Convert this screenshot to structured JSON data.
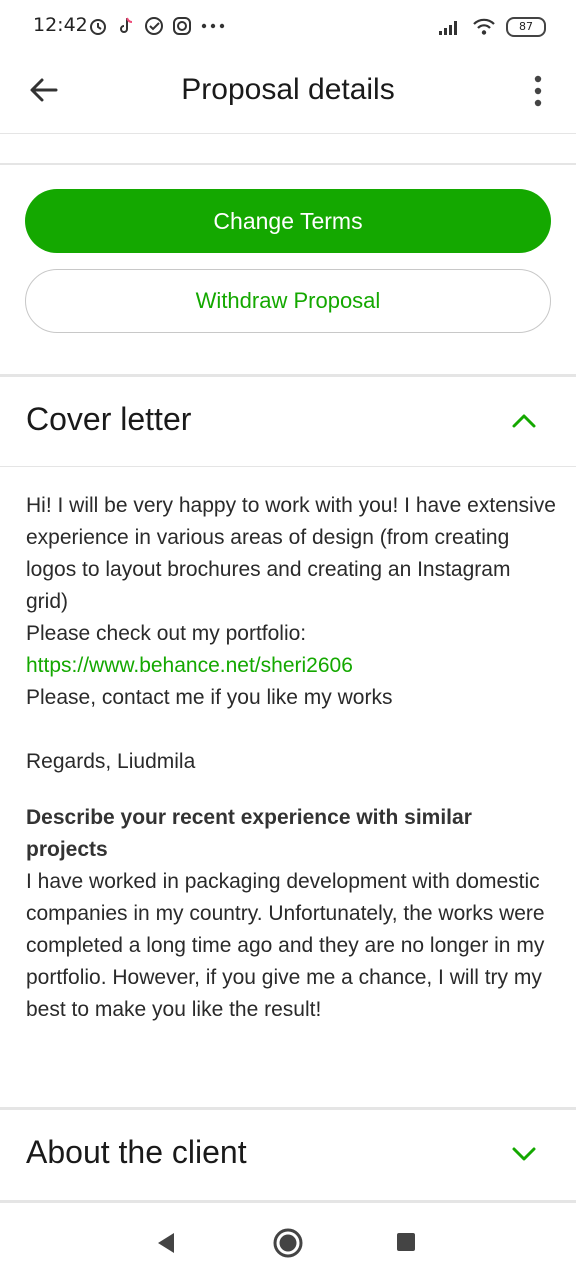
{
  "status_bar": {
    "time": "12:42",
    "battery": "87",
    "icons_left": [
      "alarm-icon",
      "tiktok-icon",
      "check-circle-icon",
      "instagram-icon",
      "more-dots-icon"
    ],
    "icons_right": [
      "signal-icon",
      "wifi-icon",
      "battery-icon"
    ]
  },
  "app_bar": {
    "title": "Proposal details",
    "back_icon": "arrow-left-icon",
    "menu_icon": "vertical-dots-icon"
  },
  "actions": {
    "change_terms": "Change Terms",
    "withdraw": "Withdraw Proposal"
  },
  "cover_letter": {
    "title": "Cover letter",
    "expanded": true,
    "lines": {
      "intro": "Hi! I will be very happy to work with you! I have extensive experience in various areas of design (from creating logos to layout brochures and creating an Instagram grid)",
      "portfolio_prompt": "Please check out my portfolio:",
      "portfolio_link": "https://www.behance.net/sheri2606",
      "contact": "Please, contact me if you like my works",
      "regards": "Regards, Liudmila"
    },
    "question": {
      "title": "Describe your recent experience with similar projects",
      "answer": "I have worked in packaging development with domestic companies in my country. Unfortunately, the works were completed a long time ago and they are no longer in my portfolio. However, if you give me a chance, I will try my best to make you like the result!"
    }
  },
  "about_client": {
    "title": "About the client",
    "expanded": false
  },
  "colors": {
    "accent": "#14a800",
    "text": "#1f1f1f",
    "divider": "#e5e5e5"
  },
  "nav_bar": {
    "icons": [
      "nav-back-icon",
      "nav-home-icon",
      "nav-recents-icon"
    ]
  }
}
